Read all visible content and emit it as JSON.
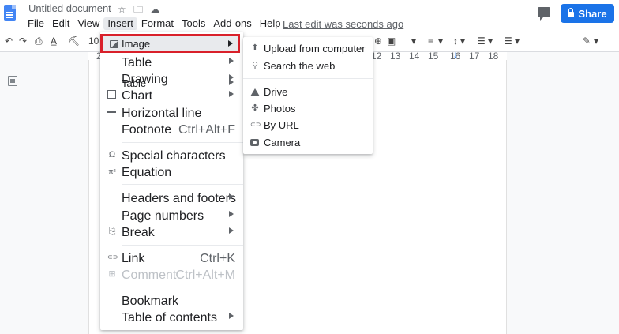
{
  "header": {
    "doc_title": "Untitled document",
    "star_icon": "☆",
    "folder_icon": "🗀",
    "cloud_icon": "☁",
    "last_edit": "Last edit was seconds ago",
    "share_label": "Share"
  },
  "menubar": [
    "File",
    "Edit",
    "View",
    "Insert",
    "Format",
    "Tools",
    "Add-ons",
    "Help"
  ],
  "toolbar": {
    "undo": "↶",
    "redo": "↷",
    "print": "⎙",
    "spellcheck": "A̲",
    "paint": "⛏",
    "zoom": "10",
    "right_icons": [
      "⊕",
      "▣",
      "▾",
      "≡",
      "▾",
      "↕",
      "▾",
      "☰",
      "▾",
      "☰",
      "▾",
      "✎",
      "▾"
    ]
  },
  "ruler": {
    "ticks": [
      "2",
      "12",
      "13",
      "14",
      "15",
      "16",
      "17",
      "18"
    ],
    "indent_marker": "↓"
  },
  "insert_menu": {
    "items": {
      "image": "Image",
      "table": "Table",
      "drawing": "Drawing",
      "chart": "Chart",
      "horizontal_line": "Horizontal line",
      "footnote": "Footnote",
      "footnote_shortcut": "Ctrl+Alt+F",
      "special_characters": "Special characters",
      "equation": "Equation",
      "headers_footers": "Headers and footers",
      "page_numbers": "Page numbers",
      "break": "Break",
      "link": "Link",
      "link_shortcut": "Ctrl+K",
      "comment": "Comment",
      "comment_shortcut": "Ctrl+Alt+M",
      "bookmark": "Bookmark",
      "table_of_contents": "Table of contents"
    },
    "icons": {
      "special_characters": "Ω",
      "equation": "π²",
      "break": "⎘",
      "link": "⊂⊃",
      "comment": "⊞"
    }
  },
  "image_submenu": {
    "items": {
      "upload": "Upload from computer",
      "search": "Search the web",
      "drive": "Drive",
      "photos": "Photos",
      "by_url": "By URL",
      "camera": "Camera"
    },
    "icons": {
      "search": "⚲",
      "photos": "✤",
      "by_url": "⊂⊃"
    }
  }
}
